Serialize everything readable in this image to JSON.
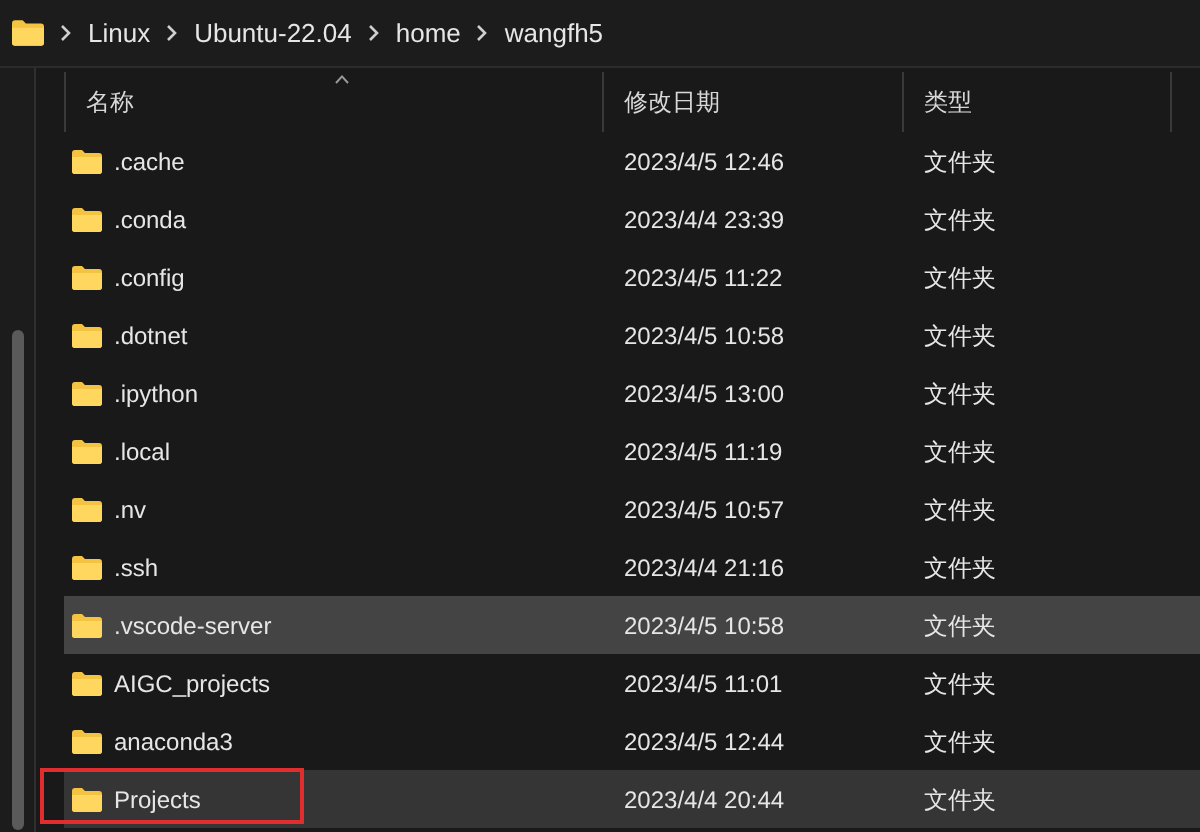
{
  "breadcrumb": [
    "Linux",
    "Ubuntu-22.04",
    "home",
    "wangfh5"
  ],
  "columns": [
    {
      "label": "名称",
      "sorted": true
    },
    {
      "label": "修改日期",
      "sorted": false
    },
    {
      "label": "类型",
      "sorted": false
    }
  ],
  "rows": [
    {
      "name": ".cache",
      "date": "2023/4/5 12:46",
      "type": "文件夹",
      "selected": false,
      "hovered": false,
      "outlined": false
    },
    {
      "name": ".conda",
      "date": "2023/4/4 23:39",
      "type": "文件夹",
      "selected": false,
      "hovered": false,
      "outlined": false
    },
    {
      "name": ".config",
      "date": "2023/4/5 11:22",
      "type": "文件夹",
      "selected": false,
      "hovered": false,
      "outlined": false
    },
    {
      "name": ".dotnet",
      "date": "2023/4/5 10:58",
      "type": "文件夹",
      "selected": false,
      "hovered": false,
      "outlined": false
    },
    {
      "name": ".ipython",
      "date": "2023/4/5 13:00",
      "type": "文件夹",
      "selected": false,
      "hovered": false,
      "outlined": false
    },
    {
      "name": ".local",
      "date": "2023/4/5 11:19",
      "type": "文件夹",
      "selected": false,
      "hovered": false,
      "outlined": false
    },
    {
      "name": ".nv",
      "date": "2023/4/5 10:57",
      "type": "文件夹",
      "selected": false,
      "hovered": false,
      "outlined": false
    },
    {
      "name": ".ssh",
      "date": "2023/4/4 21:16",
      "type": "文件夹",
      "selected": false,
      "hovered": false,
      "outlined": false
    },
    {
      "name": ".vscode-server",
      "date": "2023/4/5 10:58",
      "type": "文件夹",
      "selected": true,
      "hovered": false,
      "outlined": false
    },
    {
      "name": "AIGC_projects",
      "date": "2023/4/5 11:01",
      "type": "文件夹",
      "selected": false,
      "hovered": false,
      "outlined": false
    },
    {
      "name": "anaconda3",
      "date": "2023/4/5 12:44",
      "type": "文件夹",
      "selected": false,
      "hovered": false,
      "outlined": false
    },
    {
      "name": "Projects",
      "date": "2023/4/4 20:44",
      "type": "文件夹",
      "selected": false,
      "hovered": true,
      "outlined": true
    }
  ]
}
